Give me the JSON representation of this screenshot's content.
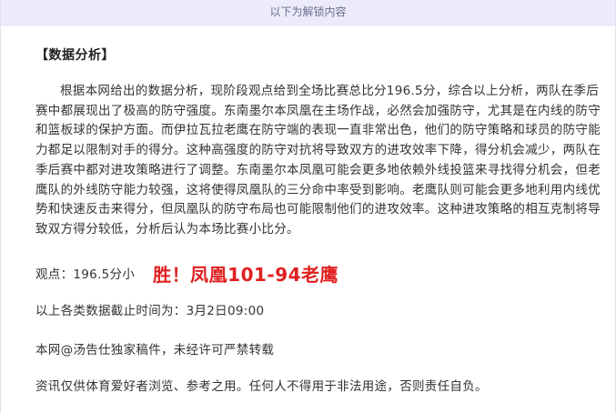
{
  "banner": {
    "text": "以下为解锁内容"
  },
  "article": {
    "section_title": "【数据分析】",
    "analysis": "根据本网给出的数据分析，现阶段观点给到全场比赛总比分196.5分，综合以上分析，两队在季后赛中都展现出了极高的防守强度。东南墨尔本凤凰在主场作战，必然会加强防守，尤其是在内线的防守和篮板球的保护方面。而伊拉瓦拉老鹰在防守端的表现一直非常出色，他们的防守策略和球员的防守能力都足以限制对手的得分。这种高强度的防守对抗将导致双方的进攻效率下降，得分机会减少，两队在季后赛中都对进攻策略进行了调整。东南墨尔本凤凰可能会更多地依赖外线投篮来寻找得分机会，但老鹰队的外线防守能力较强，这将使得凤凰队的三分命中率受到影响。老鹰队则可能会更多地利用内线优势和快速反击来得分，但凤凰队的防守布局也可能限制他们的进攻效率。这种进攻策略的相互克制将导致双方得分较低，分析后认为本场比赛小比分。",
    "viewpoint_label": "观点：196.5分小",
    "result": "胜！凤凰101-94老鹰",
    "deadline": "以上各类数据截止时间为：3月2日09:00",
    "copyright": "本网@汤告仕独家稿件，未经许可严禁转载",
    "disclaimer": "资讯仅供体育爱好者浏览、参考之用。任何人不得用于非法用途，否则责任自负。"
  },
  "colors": {
    "banner_bg": "#ecebfa",
    "banner_text": "#6b6f8f",
    "result_red": "#e02020",
    "body_text": "#333333"
  }
}
